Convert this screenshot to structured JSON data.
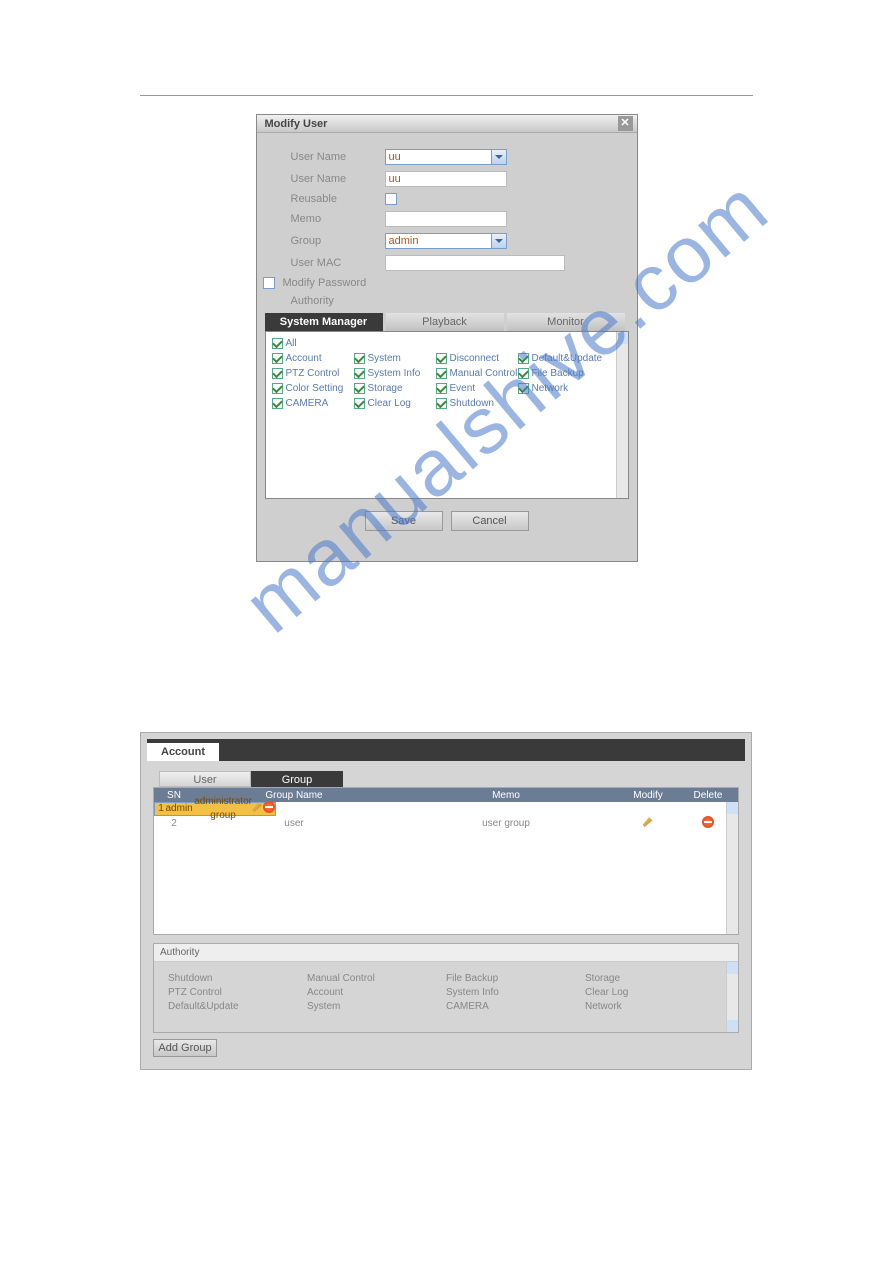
{
  "watermark": "manualshive.com",
  "dialog": {
    "title": "Modify User",
    "fields": {
      "user_select_label": "User Name",
      "user_select_value": "uu",
      "user_name_label": "User Name",
      "user_name_value": "uu",
      "reusable_label": "Reusable",
      "memo_label": "Memo",
      "group_label": "Group",
      "group_value": "admin",
      "mac_label": "User MAC",
      "modify_pw_label": "Modify Password",
      "authority_label": "Authority"
    },
    "tabs": [
      "System Manager",
      "Playback",
      "Monitor"
    ],
    "perms": {
      "row0": [
        "All"
      ],
      "rows": [
        [
          "Account",
          "System",
          "Disconnect",
          "Default&Update"
        ],
        [
          "PTZ Control",
          "System Info",
          "Manual Control",
          "File Backup"
        ],
        [
          "Color Setting",
          "Storage",
          "Event",
          "Network"
        ],
        [
          "CAMERA",
          "Clear Log",
          "Shutdown",
          ""
        ]
      ]
    },
    "buttons": {
      "save": "Save",
      "cancel": "Cancel"
    }
  },
  "account": {
    "tab": "Account",
    "subtabs": {
      "user": "User",
      "group": "Group"
    },
    "cols": {
      "sn": "SN",
      "gn": "Group Name",
      "memo": "Memo",
      "mod": "Modify",
      "del": "Delete"
    },
    "rows": [
      {
        "sn": "1",
        "gn": "admin",
        "memo": "administrator group"
      },
      {
        "sn": "2",
        "gn": "user",
        "memo": "user group"
      }
    ],
    "auth_title": "Authority",
    "auth_cols": [
      [
        "Shutdown",
        "PTZ Control",
        "Default&Update"
      ],
      [
        "Manual Control",
        "Account",
        "System"
      ],
      [
        "File Backup",
        "System Info",
        "CAMERA"
      ],
      [
        "Storage",
        "Clear Log",
        "Network"
      ]
    ],
    "add_group": "Add Group"
  }
}
